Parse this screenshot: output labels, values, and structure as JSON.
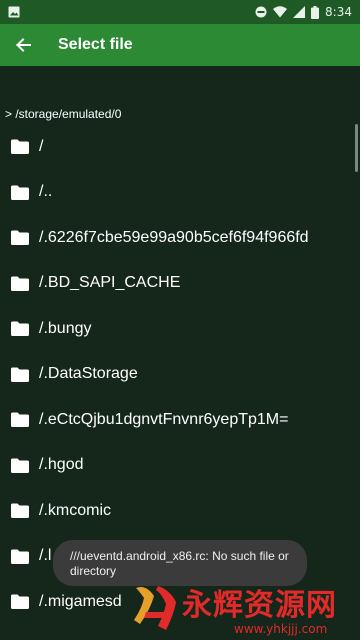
{
  "status_bar": {
    "time": "8:34",
    "icons": [
      "image-icon",
      "dnd-icon",
      "wifi-icon",
      "signal-icon",
      "battery-icon"
    ]
  },
  "app_bar": {
    "title": "Select file",
    "back_icon": "back-arrow-icon"
  },
  "path": "> /storage/emulated/0",
  "files": [
    {
      "name": "/"
    },
    {
      "name": "/.."
    },
    {
      "name": "/.6226f7cbe59e99a90b5cef6f94f966fd"
    },
    {
      "name": "/.BD_SAPI_CACHE"
    },
    {
      "name": "/.bungy"
    },
    {
      "name": "/.DataStorage"
    },
    {
      "name": "/.eCtcQjbu1dgnvtFnvnr6yepTp1M="
    },
    {
      "name": "/.hgod"
    },
    {
      "name": "/.kmcomic"
    },
    {
      "name": "/.l"
    },
    {
      "name": "/.migamesd"
    }
  ],
  "toast": {
    "text": "///ueventd.android_x86.rc: No such file or directory"
  },
  "watermark": {
    "text": "永辉资源网",
    "url": "www.yhkjjj.com"
  },
  "colors": {
    "status_bar": "#1f5a26",
    "app_bar": "#2c8a35",
    "background": "#15261b",
    "watermark": "#e12a2a"
  }
}
